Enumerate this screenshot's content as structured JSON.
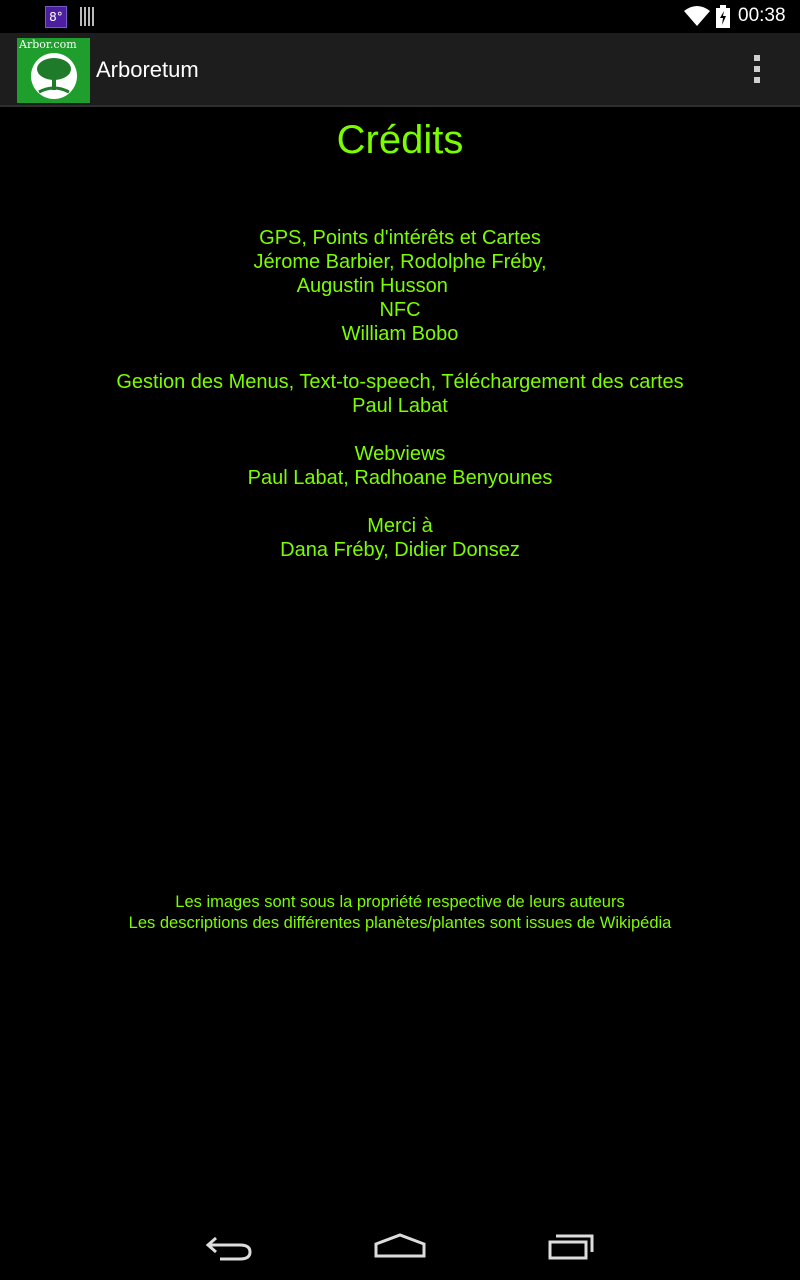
{
  "status_bar": {
    "weather_badge": "8°",
    "time": "00:38",
    "icons": [
      "weather-icon",
      "barcode-icon",
      "wifi-icon",
      "battery-charging-icon"
    ]
  },
  "action_bar": {
    "logo_text": "Arbor.com",
    "title": "Arboretum",
    "menu_icon": "overflow-menu-icon"
  },
  "credits": {
    "title": "Crédits",
    "blocks": [
      [
        "GPS, Points d'intérêts et Cartes",
        "Jérome Barbier, Rodolphe Fréby,",
        "Augustin Husson          ",
        "NFC",
        "William Bobo"
      ],
      [
        "Gestion des Menus, Text-to-speech, Téléchargement des cartes",
        "Paul Labat"
      ],
      [
        "Webviews",
        "Paul Labat, Radhoane Benyounes"
      ],
      [
        "Merci à",
        "Dana Fréby, Didier Donsez"
      ]
    ],
    "footer": [
      "Les images sont sous la propriété respective de leurs auteurs",
      "Les descriptions des différentes planètes/plantes sont issues de Wikipédia"
    ]
  },
  "nav_bar": {
    "icons": [
      "back-icon",
      "home-icon",
      "recent-apps-icon"
    ]
  },
  "colors": {
    "text_green": "#7cfc00",
    "action_bar": "#1d1d1d",
    "logo_green": "#1f9e2d"
  }
}
